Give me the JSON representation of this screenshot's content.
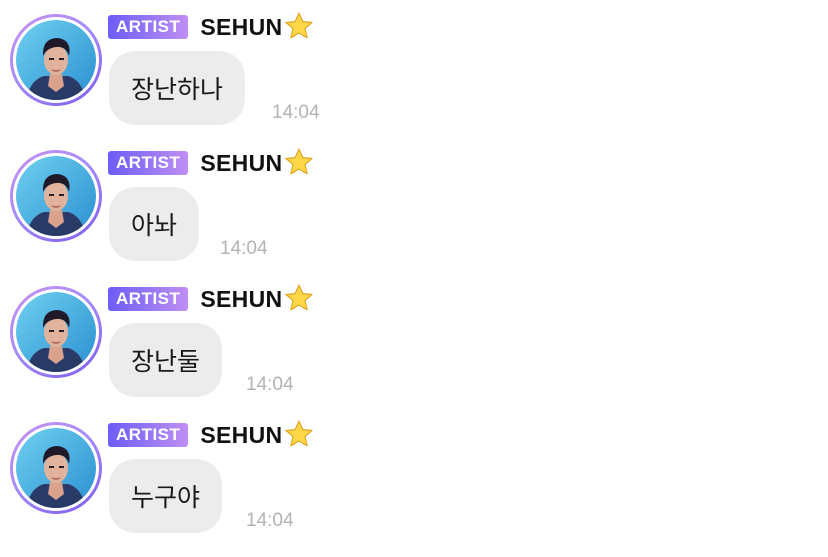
{
  "messages": [
    {
      "badge": "ARTIST",
      "sender": "SEHUN",
      "star_icon": "star-emoji",
      "text": "장난하나",
      "time": "14:04"
    },
    {
      "badge": "ARTIST",
      "sender": "SEHUN",
      "star_icon": "star-emoji",
      "text": "아놔",
      "time": "14:04"
    },
    {
      "badge": "ARTIST",
      "sender": "SEHUN",
      "star_icon": "star-emoji",
      "text": "장난둘",
      "time": "14:04"
    },
    {
      "badge": "ARTIST",
      "sender": "SEHUN",
      "star_icon": "star-emoji",
      "text": "누구야",
      "time": "14:04"
    }
  ],
  "colors": {
    "badge_gradient_start": "#6d5cf6",
    "badge_gradient_end": "#c08df2",
    "bubble_bg": "#ececec",
    "time_text": "#b3b3b3",
    "avatar_ring": "#a78bfa"
  }
}
